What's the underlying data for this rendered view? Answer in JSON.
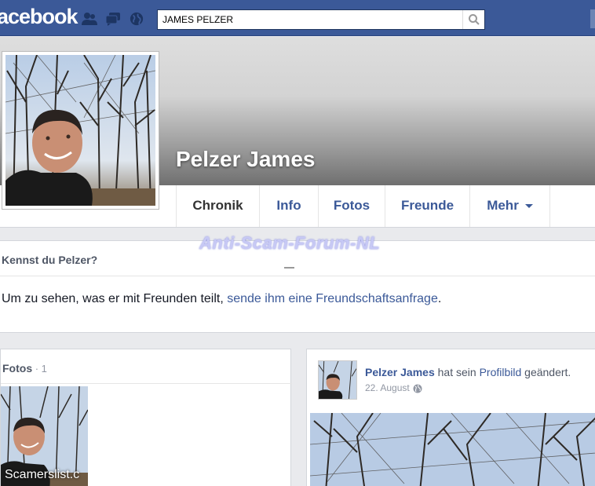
{
  "header": {
    "logo_text": "acebook",
    "search_value": "JAMES PELZER"
  },
  "profile": {
    "name": "Pelzer James"
  },
  "tabs": [
    {
      "label": "Chronik"
    },
    {
      "label": "Info"
    },
    {
      "label": "Fotos"
    },
    {
      "label": "Freunde"
    },
    {
      "label": "Mehr"
    }
  ],
  "watermark": "Anti-Scam-Forum-NL",
  "know_box": {
    "title": "Kennst du Pelzer?",
    "text_before": "Um zu sehen, was er mit Freunden teilt, ",
    "link_text": "sende ihm eine Freundschaftsanfrage",
    "text_after": "."
  },
  "photos_card": {
    "title": "Fotos",
    "count": " · 1"
  },
  "post": {
    "author": "Pelzer James",
    "action_before": " hat sein ",
    "action_link": "Profilbild",
    "action_after": " geändert.",
    "date": "22. August"
  },
  "overlay_text": "Scamerslist.c",
  "colors": {
    "brand_blue": "#3b5998",
    "background": "#e9eaed"
  },
  "icons": [
    "friend-requests-icon",
    "messages-icon",
    "notifications-globe-icon",
    "search-icon",
    "globe-icon"
  ]
}
